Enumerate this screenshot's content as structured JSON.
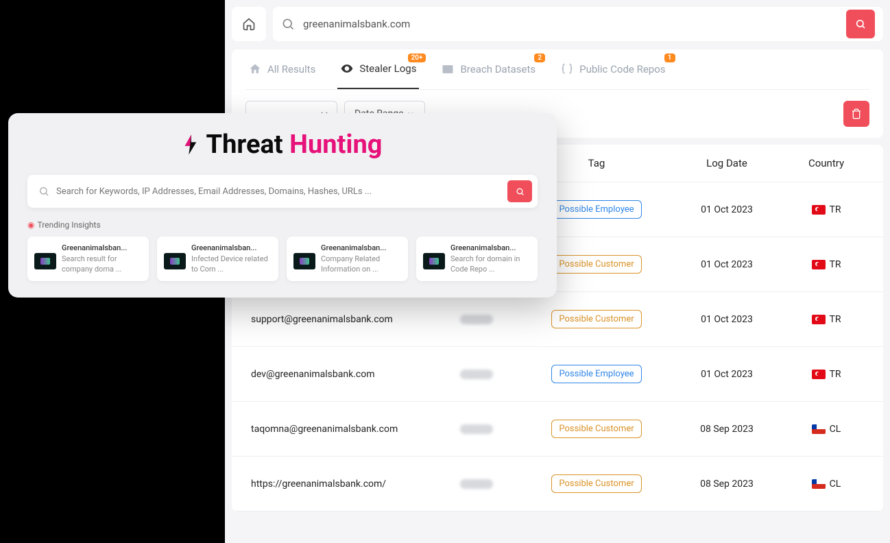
{
  "search": {
    "value": "greenanimalsbank.com"
  },
  "tabs": {
    "all": {
      "label": "All Results"
    },
    "stealer": {
      "label": "Stealer Logs",
      "badge": "20+"
    },
    "breach": {
      "label": "Breach Datasets",
      "badge": "2"
    },
    "code": {
      "label": "Public Code Repos",
      "badge": "1"
    }
  },
  "filters": {
    "daterange_label": "Date Range"
  },
  "table": {
    "headers": {
      "c3": "Tag",
      "c4": "Log Date",
      "c5": "Country"
    },
    "rows": [
      {
        "c1": "",
        "tag": "Possible Employee",
        "tag_type": "employee",
        "date": "01 Oct 2023",
        "country": "TR",
        "flag": "tr"
      },
      {
        "c1": "",
        "tag": "Possible Customer",
        "tag_type": "customer",
        "date": "01 Oct 2023",
        "country": "TR",
        "flag": "tr"
      },
      {
        "c1": "support@greenanimalsbank.com",
        "tag": "Possible Customer",
        "tag_type": "customer",
        "date": "01 Oct 2023",
        "country": "TR",
        "flag": "tr"
      },
      {
        "c1": "dev@greenanimalsbank.com",
        "tag": "Possible Employee",
        "tag_type": "employee",
        "date": "01 Oct 2023",
        "country": "TR",
        "flag": "tr"
      },
      {
        "c1": "taqomna@greenanimalsbank.com",
        "tag": "Possible Customer",
        "tag_type": "customer",
        "date": "08 Sep 2023",
        "country": "CL",
        "flag": "cl"
      },
      {
        "c1": "https://greenanimalsbank.com/",
        "tag": "Possible Customer",
        "tag_type": "customer",
        "date": "08 Sep 2023",
        "country": "CL",
        "flag": "cl"
      }
    ]
  },
  "overlay": {
    "title_pre": "Threat ",
    "title_accent": "Hunting",
    "search_placeholder": "Search for Keywords, IP Addresses, Email Addresses, Domains, Hashes, URLs ...",
    "trending_label": "Trending Insights",
    "cards": [
      {
        "title": "Greenanimalsban...",
        "sub": "Search result for company doma ..."
      },
      {
        "title": "Greenanimalsban...",
        "sub": "Infected Device related to Com ..."
      },
      {
        "title": "Greenanimalsban...",
        "sub": "Company Related Information on ..."
      },
      {
        "title": "Greenanimalsban...",
        "sub": "Search for domain in Code Repo ..."
      }
    ]
  }
}
